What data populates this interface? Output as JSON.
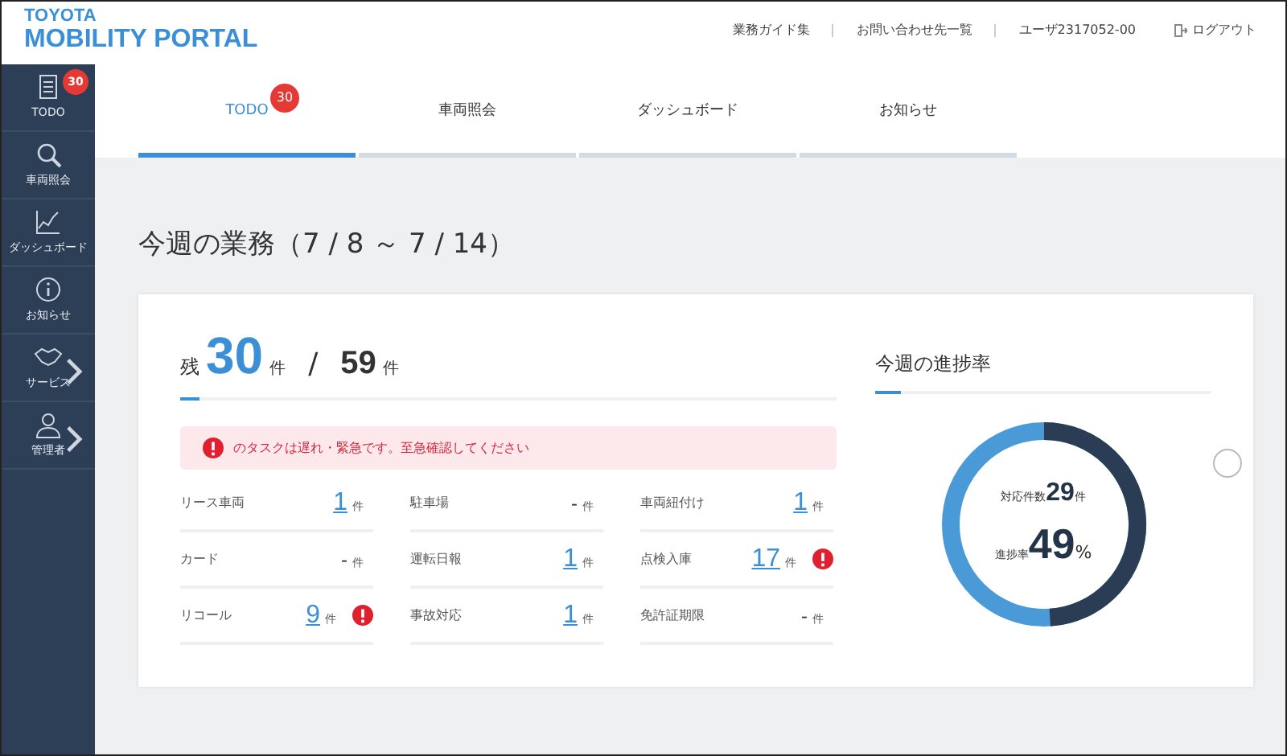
{
  "logo": {
    "line1": "TOYOTA",
    "line2": "MOBILITY PORTAL"
  },
  "header_links": [
    {
      "label": "業務ガイド集"
    },
    {
      "label": "お問い合わせ先一覧"
    },
    {
      "label": "ユーザ2317052-00"
    },
    {
      "label": "ログアウト",
      "kind": "logout"
    }
  ],
  "sidebar": {
    "items": [
      {
        "label": "TODO",
        "badge": "30",
        "expandable": false
      },
      {
        "label": "車両照会",
        "expandable": false
      },
      {
        "label": "ダッシュボード",
        "expandable": false
      },
      {
        "label": "お知らせ",
        "expandable": false
      },
      {
        "label": "サービス",
        "expandable": true
      },
      {
        "label": "管理者",
        "expandable": true
      }
    ]
  },
  "tabs": [
    {
      "label": "TODO",
      "badge": "30",
      "selected": true
    },
    {
      "label": "車両照会",
      "selected": false
    },
    {
      "label": "ダッシュボード",
      "selected": false
    },
    {
      "label": "お知らせ",
      "selected": false
    }
  ],
  "page_title": "今週の業務（7 / 8 ～ 7 / 14）",
  "summary": {
    "prefix": "残",
    "remaining": "30",
    "remaining_unit": "件",
    "separator": "/",
    "total": "59",
    "total_unit": "件"
  },
  "alert": "のタスクは遅れ・緊急です。至急確認してください",
  "tasks": [
    {
      "label": "リース車両",
      "value": "1",
      "unit": "件",
      "kind": "count",
      "alert": false
    },
    {
      "label": "駐車場",
      "value": "-",
      "unit": "件",
      "kind": "none",
      "alert": false
    },
    {
      "label": "車両紐付け",
      "value": "1",
      "unit": "件",
      "kind": "count",
      "alert": false
    },
    {
      "label": "カード",
      "value": "-",
      "unit": "件",
      "kind": "none",
      "alert": false
    },
    {
      "label": "運転日報",
      "value": "1",
      "unit": "件",
      "kind": "count",
      "alert": false
    },
    {
      "label": "点検入庫",
      "value": "17",
      "unit": "件",
      "kind": "count",
      "alert": true
    },
    {
      "label": "リコール",
      "value": "9",
      "unit": "件",
      "kind": "count",
      "alert": true
    },
    {
      "label": "事故対応",
      "value": "1",
      "unit": "件",
      "kind": "count",
      "alert": false
    },
    {
      "label": "免許証期限",
      "value": "-",
      "unit": "件",
      "kind": "none",
      "alert": false
    }
  ],
  "progress": {
    "title": "今週の進捗率",
    "count_label": "対応件数",
    "count": "29",
    "count_unit": "件",
    "rate_label": "進捗率",
    "rate": "49",
    "rate_unit": "%",
    "level": 0.49
  }
}
